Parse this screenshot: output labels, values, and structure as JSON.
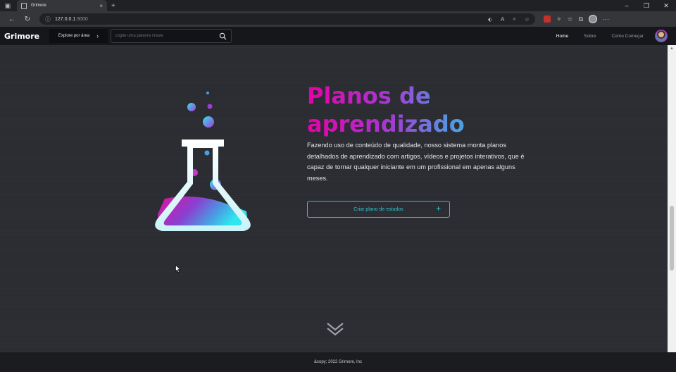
{
  "browser": {
    "tab_title": "Grimore",
    "url_host": "127.0.0.1",
    "url_port": ":3000"
  },
  "header": {
    "logo": "Grimore",
    "explore_label": "Explore por área",
    "search_placeholder": "Digite uma palavra chave",
    "menu": [
      {
        "label": "Home",
        "active": true
      },
      {
        "label": "Sobre",
        "active": false
      },
      {
        "label": "Como Começar",
        "active": false
      }
    ]
  },
  "hero": {
    "title_line1": "Planos de",
    "title_line2": "aprendizado",
    "description": "Fazendo uso de conteúdo de qualidade, nosso sistema monta planos detalhados de aprendizado com artigos, vídeos e projetos interativos, que é capaz de tornar qualquer iniciante em um profissional em apenas alguns meses.",
    "cta_label": "Criar plano de estudos"
  },
  "footer": {
    "text": "&copy; 2022 Grimore, Inc"
  },
  "colors": {
    "accent_pink": "#e600a8",
    "accent_cyan": "#1ed6ea",
    "cta_border": "#2fc0c8",
    "background": "#2a2c32"
  },
  "icons": [
    "browser-tab-icon",
    "back-icon",
    "refresh-icon",
    "info-icon",
    "search-icon",
    "chevron-right-icon",
    "plus-icon",
    "chevron-double-down-icon",
    "flask-icon"
  ]
}
